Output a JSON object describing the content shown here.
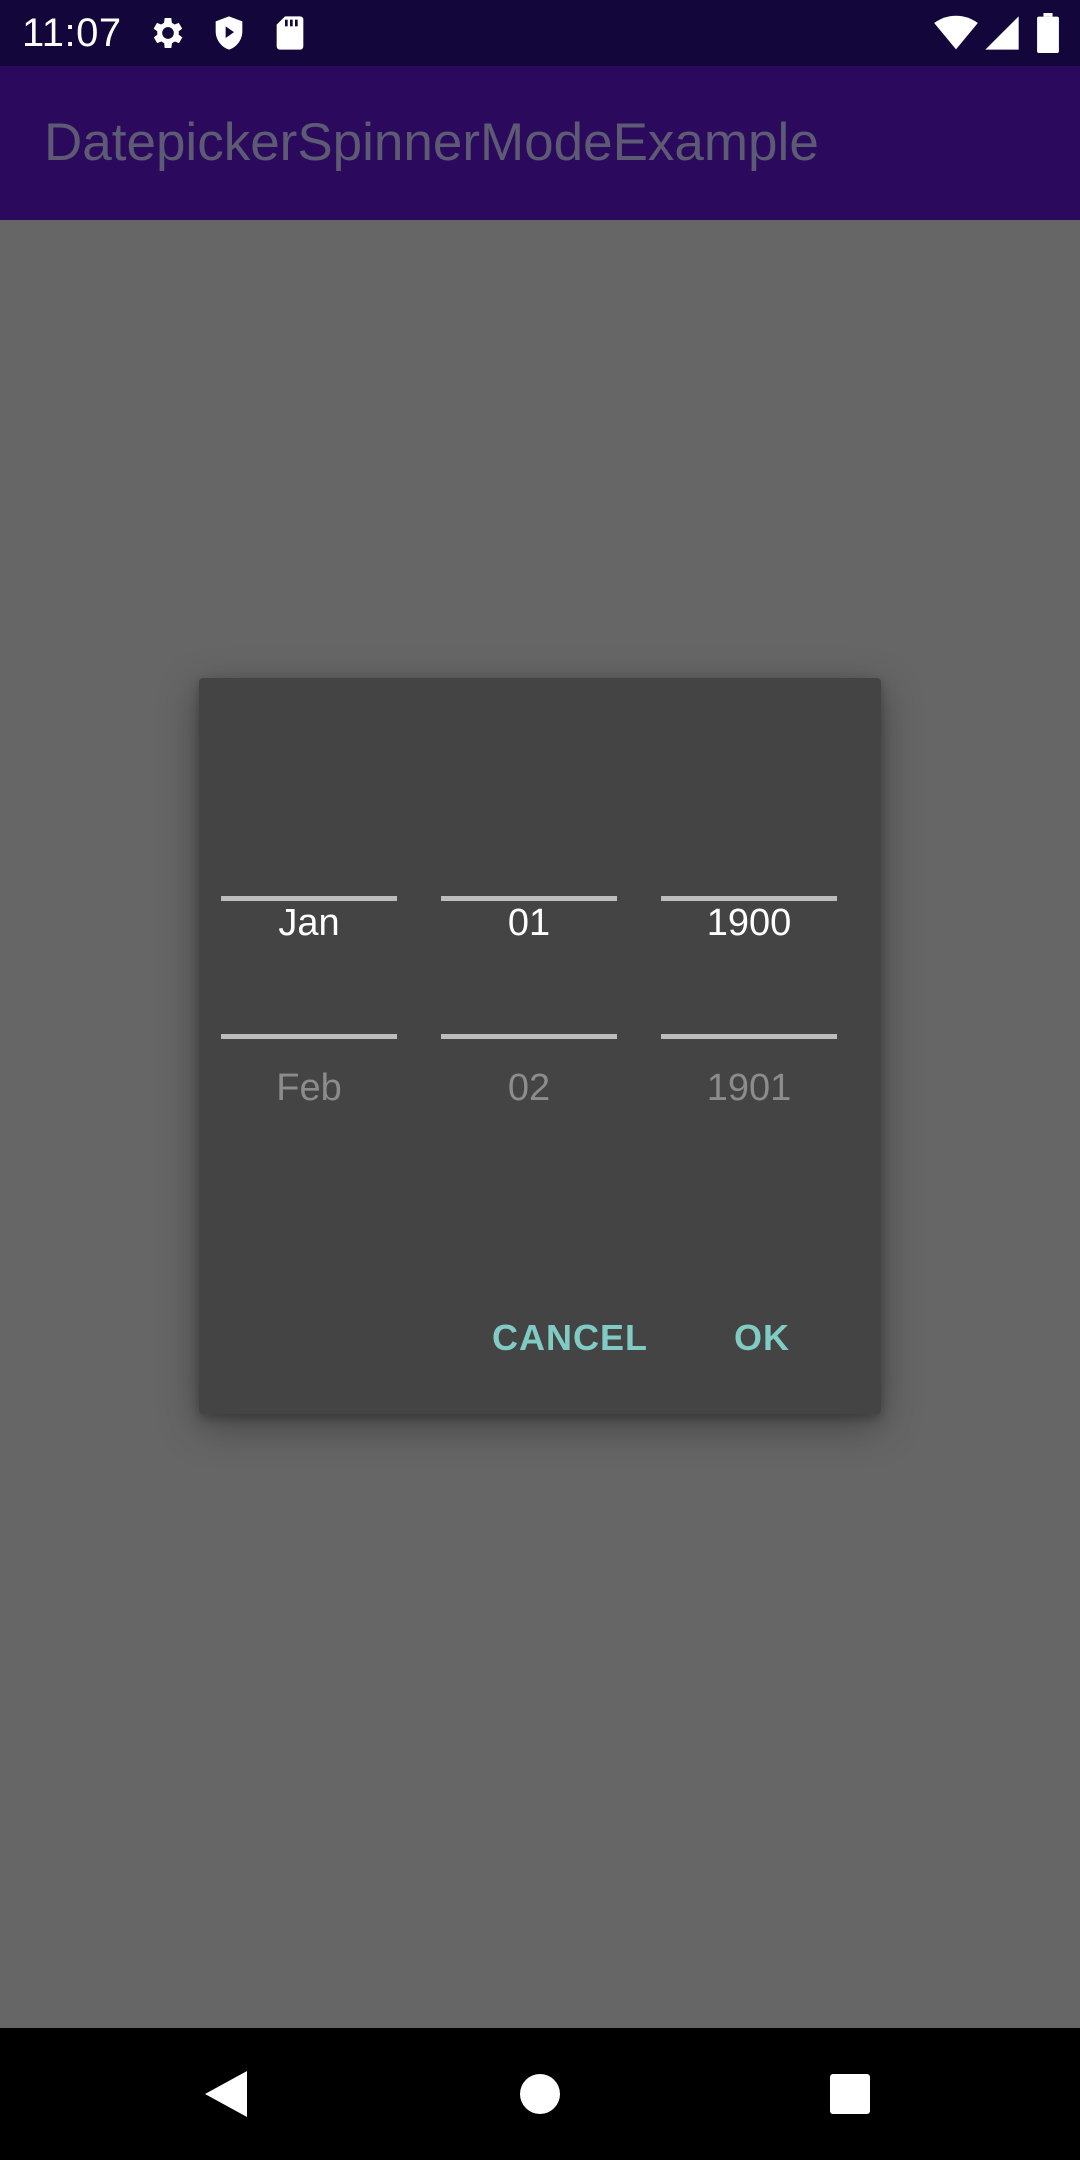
{
  "status_bar": {
    "time": "11:07",
    "left_icons": [
      "gear-icon",
      "shield-icon",
      "sd-card-icon"
    ],
    "right_icons": [
      "wifi-icon",
      "cell-signal-icon",
      "battery-icon"
    ]
  },
  "app_bar": {
    "title": "DatepickerSpinnerModeExample"
  },
  "date_picker": {
    "month": {
      "selected": "Jan",
      "next": "Feb"
    },
    "day": {
      "selected": "01",
      "next": "02"
    },
    "year": {
      "selected": "1900",
      "next": "1901"
    }
  },
  "dialog_buttons": {
    "cancel": "CANCEL",
    "ok": "OK"
  },
  "colors": {
    "status_bar": "#12063a",
    "app_bar": "#2b0a5e",
    "scrim": "#666666",
    "dialog": "#444444",
    "accent": "#80cbc4"
  },
  "nav_bar": {
    "buttons": [
      "back-icon",
      "home-icon",
      "recents-icon"
    ]
  }
}
